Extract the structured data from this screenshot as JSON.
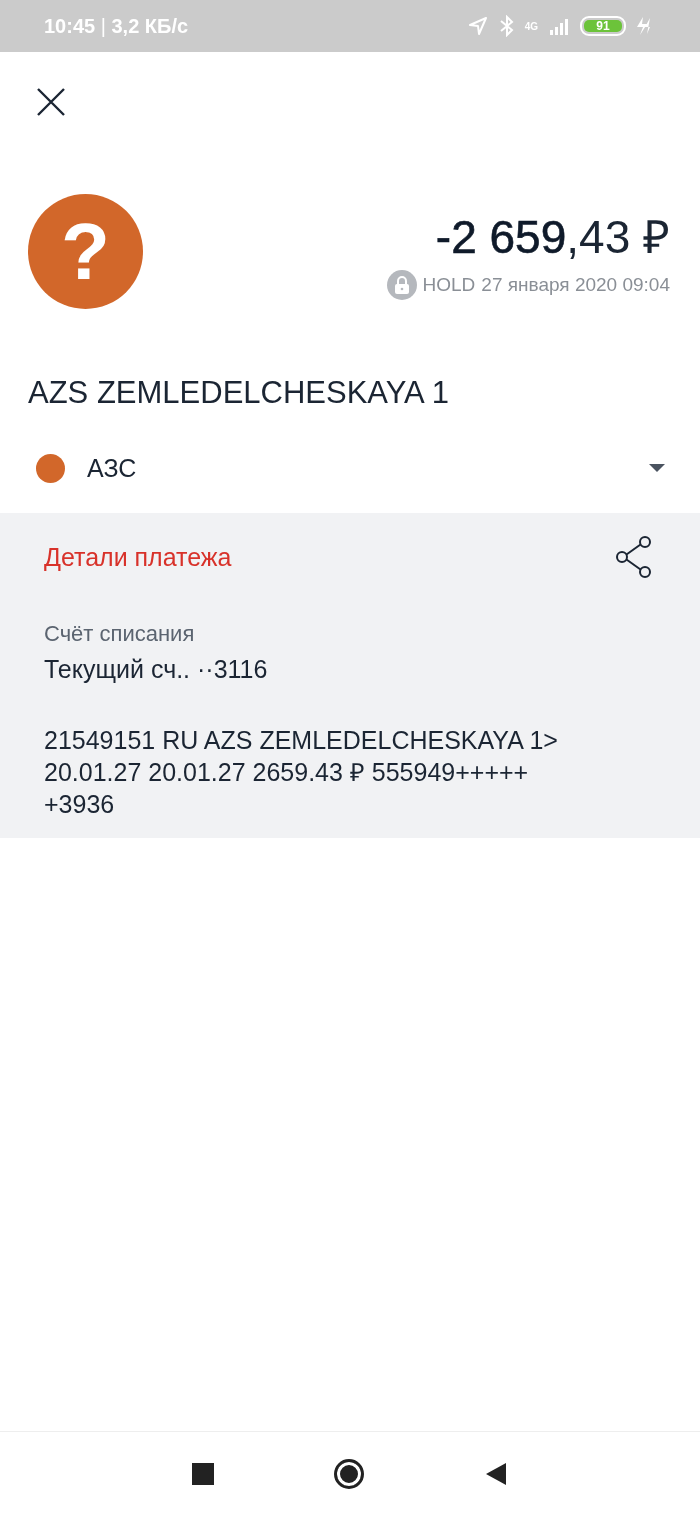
{
  "status_bar": {
    "time": "10:45",
    "separator": "|",
    "speed": "3,2 КБ/с",
    "network": "4G",
    "battery": "91"
  },
  "transaction": {
    "amount": "**-2 659**,43 ₽",
    "status": "HOLD",
    "date": "27 января 2020 09:04",
    "merchant": "AZS ZEMLEDELCHESKAYA 1",
    "avatar_glyph": "?"
  },
  "category": {
    "label": "АЗС",
    "color": "#d2672a",
    "expanded": false
  },
  "details": {
    "title": "Детали платежа",
    "account_label": "Счёт списания",
    "account_value": "Текущий сч.. ··3116",
    "description_lines": [
      "21549151 RU AZS ZEMLEDELCHESKAYA 1>",
      "20.01.27 20.01.27 2659.43 ₽ 555949+++++",
      "+3936"
    ]
  }
}
